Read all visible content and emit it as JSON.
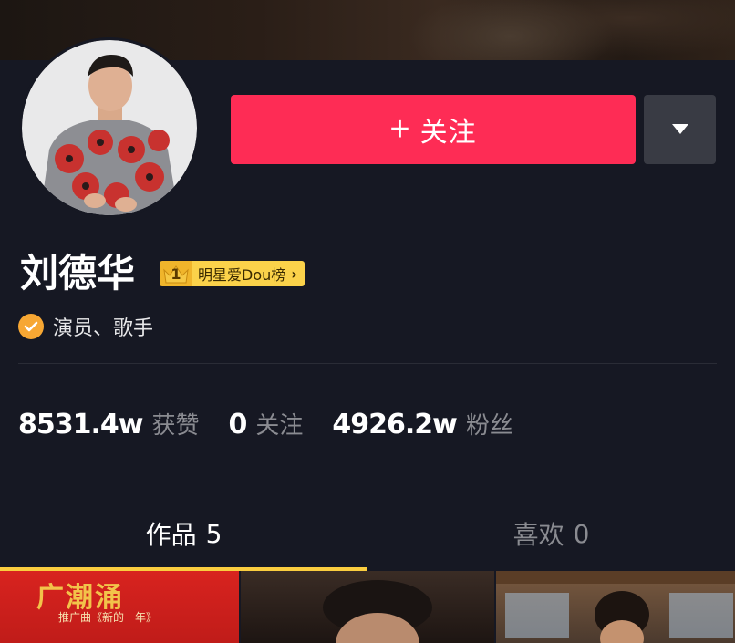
{
  "profile": {
    "name": "刘德华",
    "rank_badge": {
      "rank": "1",
      "label": "明星爱Dou榜"
    },
    "verified_text": "演员、歌手"
  },
  "actions": {
    "follow_plus": "+",
    "follow_label": "关注"
  },
  "stats": [
    {
      "value": "8531.4w",
      "label": "获赞"
    },
    {
      "value": "0",
      "label": "关注"
    },
    {
      "value": "4926.2w",
      "label": "粉丝"
    }
  ],
  "tabs": [
    {
      "label": "作品",
      "count": "5",
      "active": true
    },
    {
      "label": "喜欢",
      "count": "0",
      "active": false
    }
  ],
  "videos": {
    "first_title": "广潮涌",
    "first_subtitle": "推广曲《新的一年》"
  },
  "colors": {
    "background": "#161823",
    "follow_button": "#fe2c55",
    "tab_indicator": "#facd3f",
    "verified_badge": "#f7a733"
  }
}
